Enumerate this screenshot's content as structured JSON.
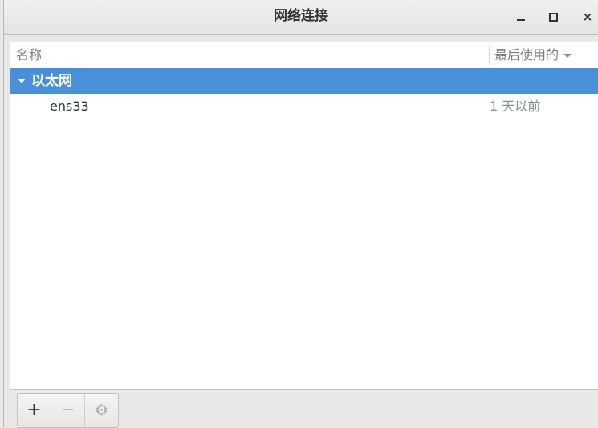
{
  "window": {
    "title": "网络连接",
    "controls": {
      "minimize": "minimize",
      "maximize": "maximize",
      "close": "×"
    }
  },
  "list": {
    "columns": {
      "name": "名称",
      "last_used": "最后使用的"
    },
    "groups": [
      {
        "label": "以太网",
        "expanded": true,
        "connections": [
          {
            "name": "ens33",
            "last_used": "1 天以前"
          }
        ]
      }
    ]
  },
  "toolbar": {
    "add": "+",
    "remove": "−",
    "settings": "⚙"
  },
  "colors": {
    "selection": "#4a90d9",
    "window_bg": "#e8e8e7",
    "text": "#2e3436"
  },
  "icons": {
    "minimize": "minimize-icon",
    "maximize": "maximize-icon",
    "close": "close-icon",
    "expander": "chevron-down-icon",
    "sort": "sort-descending-icon",
    "settings": "gear-icon"
  }
}
